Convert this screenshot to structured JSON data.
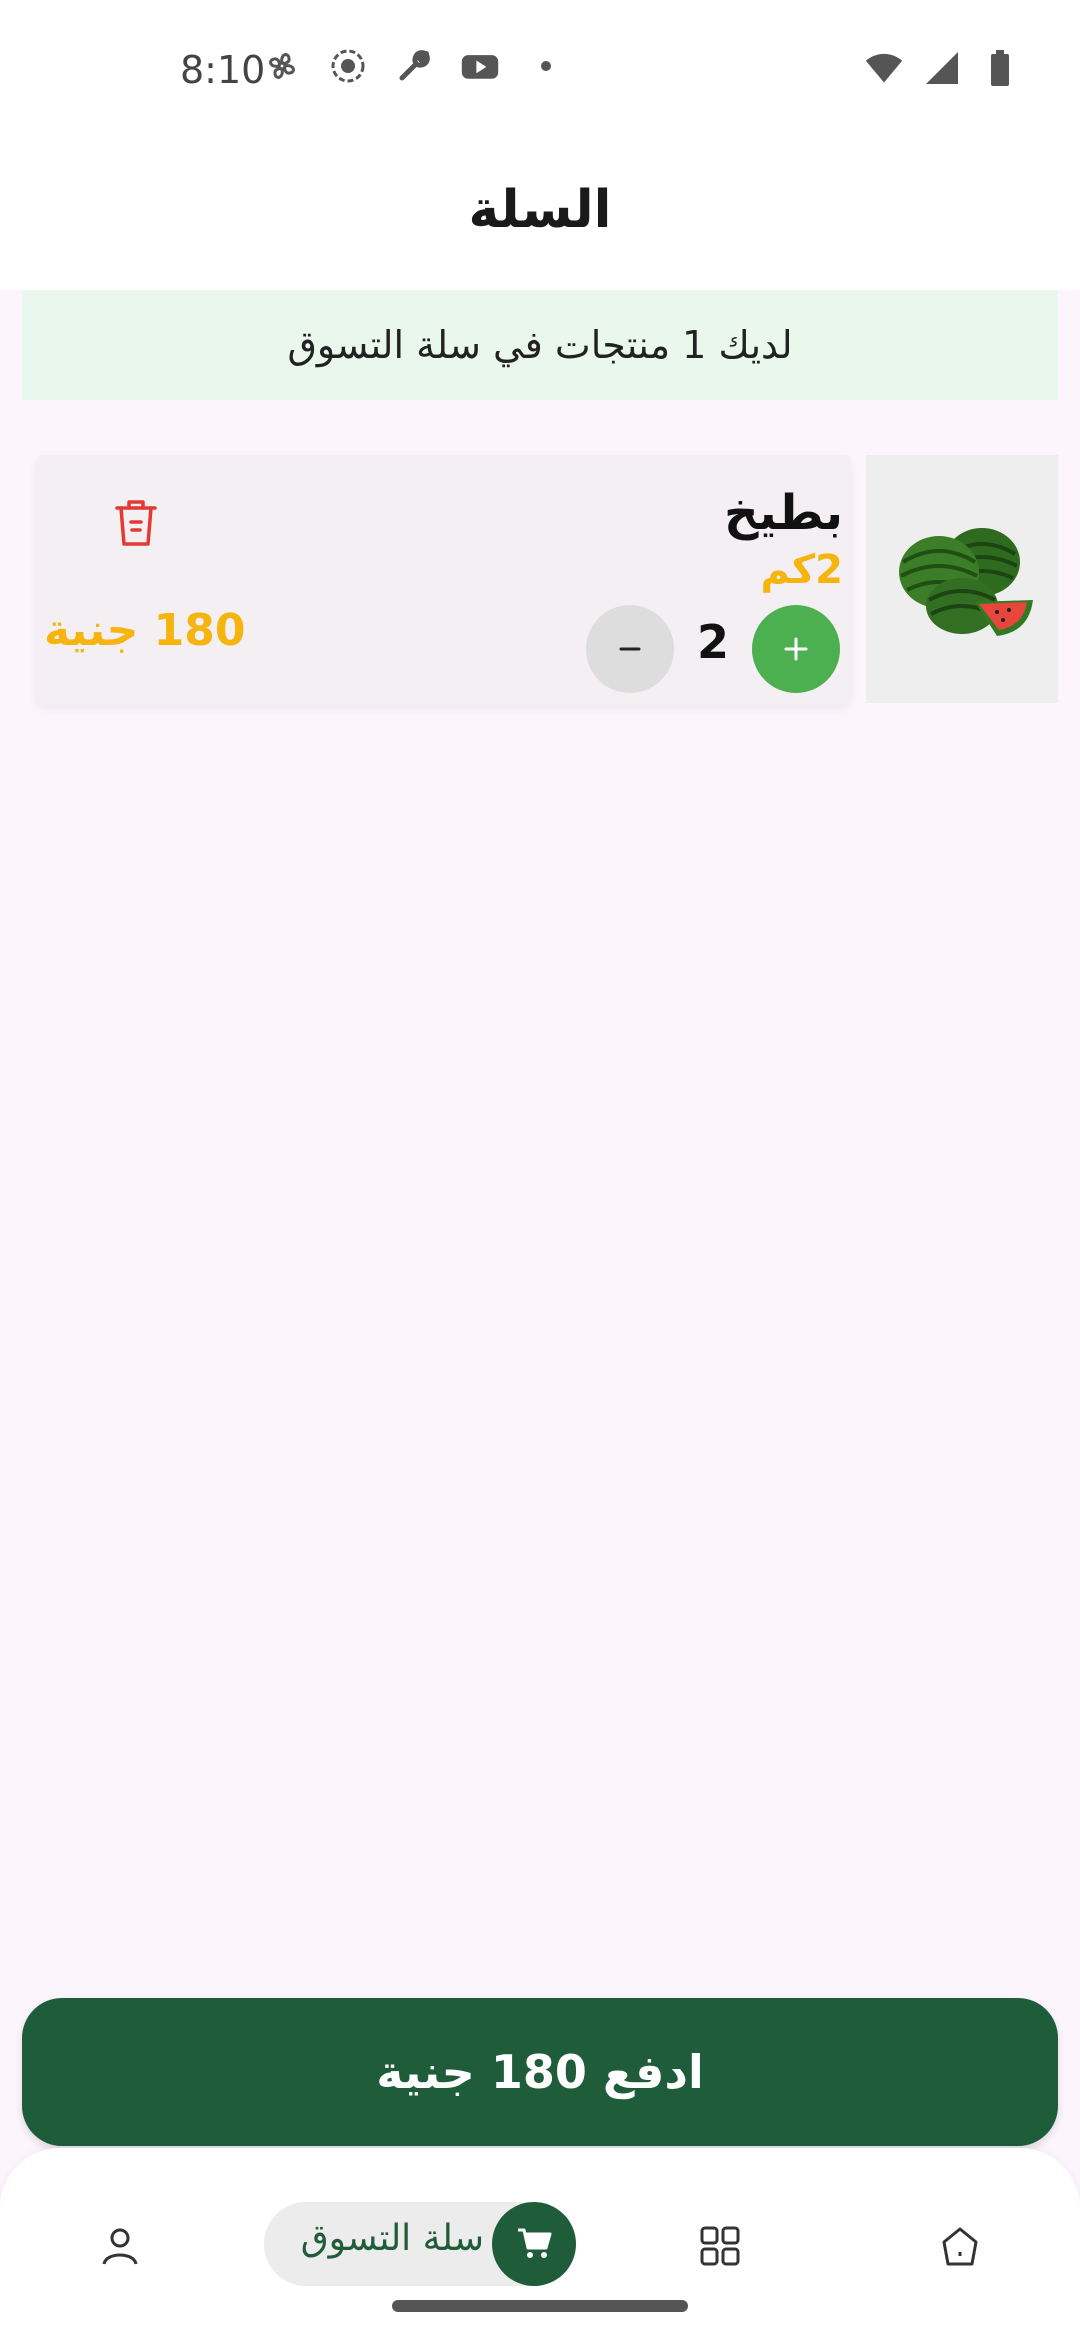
{
  "status_bar": {
    "time": "8:10",
    "left_icons": [
      "fan-icon",
      "record-icon",
      "wrench-icon",
      "youtube-icon",
      "dot-icon"
    ],
    "right_icons": [
      "wifi-icon",
      "signal-icon",
      "battery-icon"
    ]
  },
  "header": {
    "title": "السلة"
  },
  "banner": {
    "text": "لديك 1 منتجات في سلة التسوق"
  },
  "cart": {
    "items": [
      {
        "name": "بطيخ",
        "weight": "2كم",
        "quantity": "2",
        "price": "180 جنية",
        "image_icon": "watermelon-image"
      }
    ]
  },
  "actions": {
    "pay_label": "ادفع 180 جنية"
  },
  "bottom_nav": {
    "cart_label": "سلة التسوق",
    "items": [
      "profile-icon",
      "cart-icon",
      "grid-icon",
      "home-icon"
    ]
  },
  "colors": {
    "primary_green": "#1F5C3A",
    "plus_green": "#4CAF50",
    "price_yellow": "#F6B40E",
    "delete_red": "#E53935",
    "banner_bg": "#E9F7EC",
    "page_bg": "#FCF5FC"
  }
}
